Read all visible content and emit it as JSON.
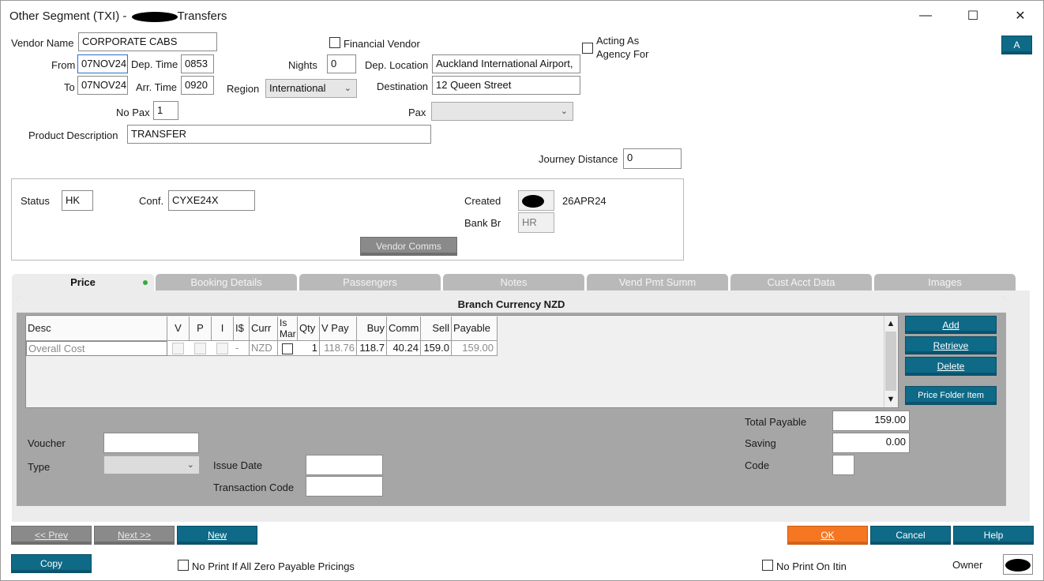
{
  "window": {
    "title_prefix": "Other Segment (TXI) -",
    "title_suffix": "Transfers",
    "minimize_glyph": "—",
    "maximize_glyph": "☐",
    "close_glyph": "✕"
  },
  "header": {
    "vendor_name_label": "Vendor Name",
    "vendor_name": "CORPORATE CABS",
    "financial_vendor_label": "Financial Vendor",
    "acting_as_label_1": "Acting As",
    "acting_as_label_2": "Agency For",
    "a_button": "A",
    "from_label": "From",
    "from_value": "07NOV24",
    "dep_time_label": "Dep. Time",
    "dep_time": "0853",
    "nights_label": "Nights",
    "nights": "0",
    "dep_location_label": "Dep. Location",
    "dep_location": "Auckland International Airport,",
    "to_label": "To",
    "to_value": "07NOV24",
    "arr_time_label": "Arr. Time",
    "arr_time": "0920",
    "region_label": "Region",
    "region": "International",
    "destination_label": "Destination",
    "destination": "12 Queen Street",
    "no_pax_label": "No Pax",
    "no_pax": "1",
    "pax_label": "Pax",
    "pax": "",
    "product_description_label": "Product Description",
    "product_description": "TRANSFER",
    "journey_distance_label": "Journey Distance",
    "journey_distance": "0"
  },
  "status_panel": {
    "status_label": "Status",
    "status": "HK",
    "conf_label": "Conf.",
    "conf": "CYXE24X",
    "created_label": "Created",
    "created_date": "26APR24",
    "bank_br_label": "Bank Br",
    "bank_br": "HR",
    "vendor_comms_button": "Vendor Comms"
  },
  "tabs": [
    {
      "label": "Price"
    },
    {
      "label": "Booking Details"
    },
    {
      "label": "Passengers"
    },
    {
      "label": "Notes"
    },
    {
      "label": "Vend Pmt Summ"
    },
    {
      "label": "Cust Acct Data"
    },
    {
      "label": "Images"
    }
  ],
  "price": {
    "branch_currency": "Branch Currency NZD",
    "columns": [
      "Desc",
      "V",
      "P",
      "I",
      "I$",
      "Curr",
      "Is Mar",
      "Qty",
      "V Pay",
      "Buy",
      "Comm",
      "Sell",
      "Payable"
    ],
    "row": {
      "desc": "Overall Cost",
      "i_dollar": "-",
      "curr": "NZD",
      "qty": "1",
      "v_pay": "118.76",
      "buy": "118.7",
      "comm": "40.24",
      "sell": "159.0",
      "payable": "159.00"
    },
    "add_button": "Add",
    "retrieve_button": "Retrieve",
    "delete_button": "Delete",
    "price_folder_button": "Price Folder Item",
    "voucher_label": "Voucher",
    "voucher": "",
    "type_label": "Type",
    "type": "",
    "issue_date_label": "Issue Date",
    "issue_date": "",
    "transaction_code_label": "Transaction Code",
    "transaction_code": "",
    "total_payable_label": "Total Payable",
    "total_payable": "159.00",
    "saving_label": "Saving",
    "saving": "0.00",
    "code_label": "Code",
    "code": ""
  },
  "footer": {
    "prev_button": "<< Prev",
    "next_button": "Next >>",
    "new_button": "New",
    "ok_button": "OK",
    "cancel_button": "Cancel",
    "help_button": "Help",
    "copy_button": "Copy",
    "no_print_zero_label": "No Print If All Zero Payable Pricings",
    "no_print_itin_label": "No Print On Itin",
    "owner_label": "Owner"
  },
  "colors": {
    "teal": "#0e6a87",
    "orange": "#f57722",
    "tab_grey": "#b9b9b9",
    "panel_grey": "#a6a6a6"
  }
}
